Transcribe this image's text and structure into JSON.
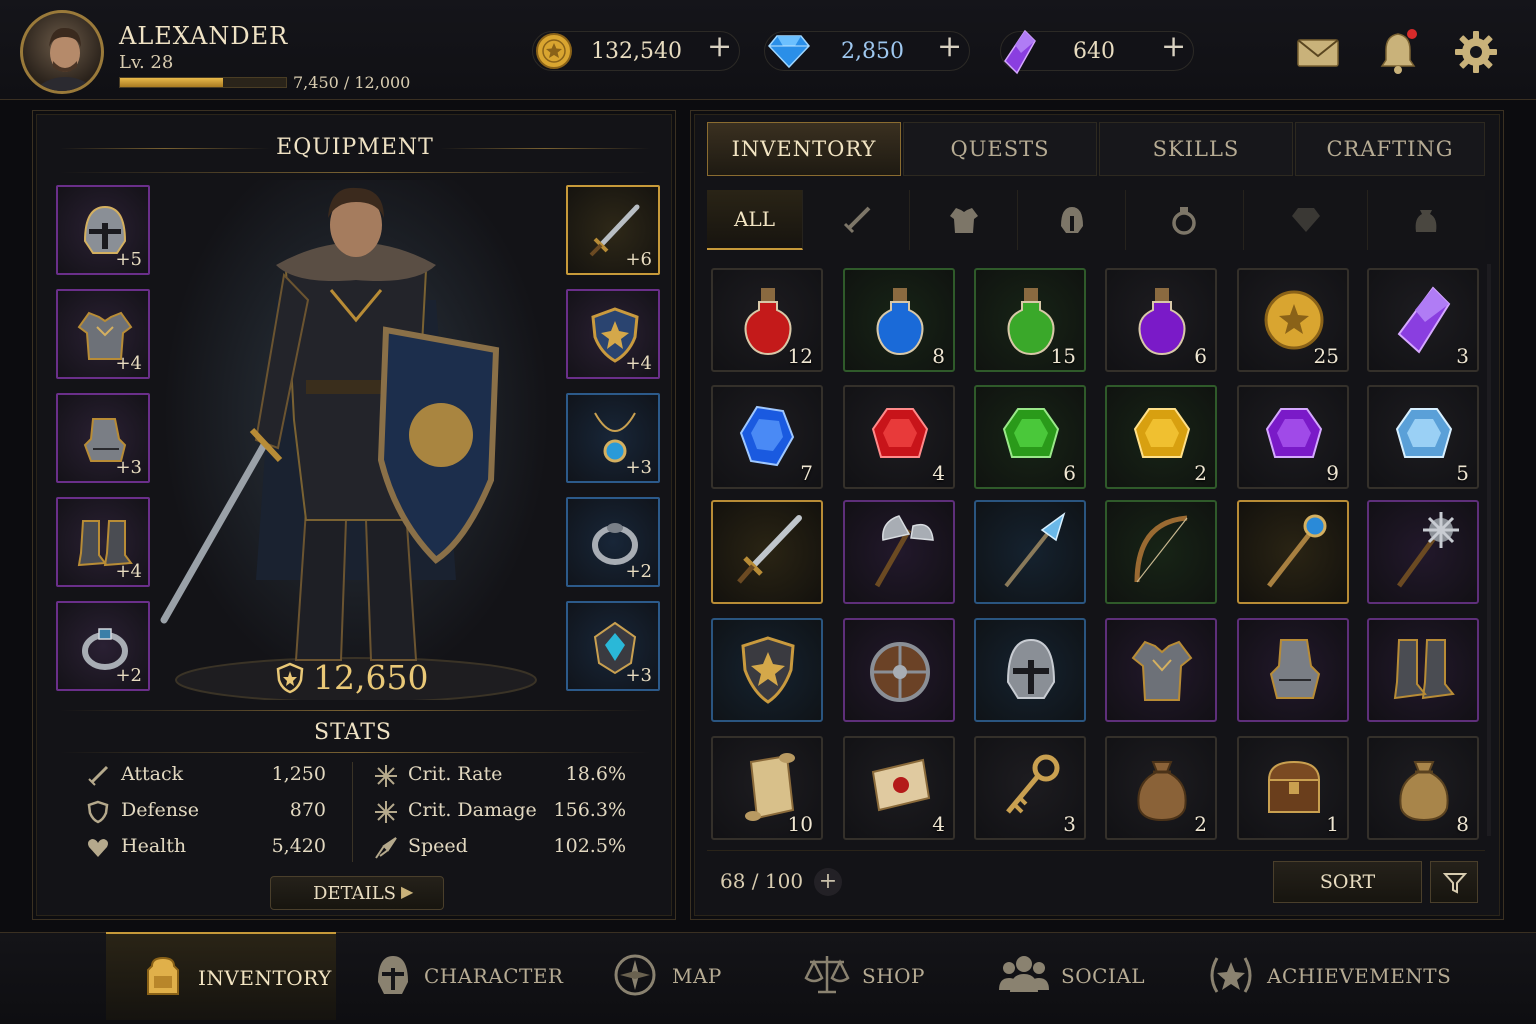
{
  "player": {
    "name": "ALEXANDER",
    "level": "Lv. 28",
    "xp_text": "7,450 / 12,000",
    "xp_progress": 0.621
  },
  "currencies": [
    {
      "name": "gold",
      "value": "132,540",
      "add": "+"
    },
    {
      "name": "gems",
      "value": "2,850",
      "add": "+"
    },
    {
      "name": "crystals",
      "value": "640",
      "add": "+"
    }
  ],
  "equipment": {
    "title": "EQUIPMENT",
    "power": "12,650",
    "left_slots": [
      {
        "icon": "helmet-icon",
        "bonus": "+5"
      },
      {
        "icon": "chest-armor-icon",
        "bonus": "+4"
      },
      {
        "icon": "gauntlets-icon",
        "bonus": "+3"
      },
      {
        "icon": "boots-icon",
        "bonus": "+4"
      },
      {
        "icon": "ring-icon",
        "bonus": "+2"
      }
    ],
    "right_slots": [
      {
        "icon": "sword-icon",
        "bonus": "+6"
      },
      {
        "icon": "shield-icon",
        "bonus": "+4"
      },
      {
        "icon": "amulet-icon",
        "bonus": "+3"
      },
      {
        "icon": "ring-icon",
        "bonus": "+2"
      },
      {
        "icon": "charm-icon",
        "bonus": "+3"
      }
    ]
  },
  "stats": {
    "title": "STATS",
    "left": [
      {
        "icon": "sword-icon",
        "label": "Attack",
        "value": "1,250"
      },
      {
        "icon": "shield-icon",
        "label": "Defense",
        "value": "870"
      },
      {
        "icon": "heart-icon",
        "label": "Health",
        "value": "5,420"
      }
    ],
    "right": [
      {
        "icon": "crit-icon",
        "label": "Crit. Rate",
        "value": "18.6%"
      },
      {
        "icon": "crit-icon",
        "label": "Crit. Damage",
        "value": "156.3%"
      },
      {
        "icon": "speed-icon",
        "label": "Speed",
        "value": "102.5%"
      }
    ],
    "details_label": "DETAILS"
  },
  "tabs": [
    "INVENTORY",
    "QUESTS",
    "SKILLS",
    "CRAFTING"
  ],
  "filters": {
    "all_label": "ALL",
    "icons": [
      "weapon-filter-icon",
      "armor-filter-icon",
      "helmet-filter-icon",
      "ring-filter-icon",
      "gem-filter-icon",
      "bag-filter-icon"
    ]
  },
  "inventory": {
    "rows": [
      [
        {
          "icon": "red-potion-icon",
          "qty": "12",
          "rarity": "none"
        },
        {
          "icon": "blue-potion-icon",
          "qty": "8",
          "rarity": "green"
        },
        {
          "icon": "green-potion-icon",
          "qty": "15",
          "rarity": "green"
        },
        {
          "icon": "purple-potion-icon",
          "qty": "6",
          "rarity": "none"
        },
        {
          "icon": "gold-coin-icon",
          "qty": "25",
          "rarity": "none"
        },
        {
          "icon": "purple-crystal-icon",
          "qty": "3",
          "rarity": "none"
        }
      ],
      [
        {
          "icon": "sapphire-icon",
          "qty": "7",
          "rarity": "none"
        },
        {
          "icon": "ruby-icon",
          "qty": "4",
          "rarity": "none"
        },
        {
          "icon": "emerald-icon",
          "qty": "6",
          "rarity": "green"
        },
        {
          "icon": "topaz-icon",
          "qty": "2",
          "rarity": "green"
        },
        {
          "icon": "amethyst-icon",
          "qty": "9",
          "rarity": "none"
        },
        {
          "icon": "diamond-icon",
          "qty": "5",
          "rarity": "none"
        }
      ],
      [
        {
          "icon": "sword-icon",
          "qty": "",
          "rarity": "gold"
        },
        {
          "icon": "axe-icon",
          "qty": "",
          "rarity": "purple"
        },
        {
          "icon": "spear-icon",
          "qty": "",
          "rarity": "blue"
        },
        {
          "icon": "bow-icon",
          "qty": "",
          "rarity": "green"
        },
        {
          "icon": "staff-icon",
          "qty": "",
          "rarity": "gold"
        },
        {
          "icon": "mace-icon",
          "qty": "",
          "rarity": "purple"
        }
      ],
      [
        {
          "icon": "shield-icon",
          "qty": "",
          "rarity": "blue"
        },
        {
          "icon": "round-shield-icon",
          "qty": "",
          "rarity": "purple"
        },
        {
          "icon": "helmet-icon",
          "qty": "",
          "rarity": "blue"
        },
        {
          "icon": "chest-armor-icon",
          "qty": "",
          "rarity": "purple"
        },
        {
          "icon": "gauntlets-icon",
          "qty": "",
          "rarity": "purple"
        },
        {
          "icon": "boots-icon",
          "qty": "",
          "rarity": "purple"
        }
      ],
      [
        {
          "icon": "scroll-icon",
          "qty": "10",
          "rarity": "none"
        },
        {
          "icon": "sealed-scroll-icon",
          "qty": "4",
          "rarity": "none"
        },
        {
          "icon": "key-icon",
          "qty": "3",
          "rarity": "none"
        },
        {
          "icon": "pouch-icon",
          "qty": "2",
          "rarity": "none"
        },
        {
          "icon": "chest-icon",
          "qty": "1",
          "rarity": "none"
        },
        {
          "icon": "pouch-icon",
          "qty": "8",
          "rarity": "none"
        }
      ]
    ],
    "capacity": "68 / 100",
    "add": "+",
    "sort_label": "SORT"
  },
  "bottom_nav": [
    {
      "icon": "backpack-icon",
      "label": "INVENTORY"
    },
    {
      "icon": "helmet-icon",
      "label": "CHARACTER"
    },
    {
      "icon": "compass-icon",
      "label": "MAP"
    },
    {
      "icon": "scales-icon",
      "label": "SHOP"
    },
    {
      "icon": "people-icon",
      "label": "SOCIAL"
    },
    {
      "icon": "laurel-star-icon",
      "label": "ACHIEVEMENTS"
    }
  ],
  "colors": {
    "accent": "#c79a3a",
    "rarity_green": "#2f5a2a",
    "rarity_purple": "#5e2f7a",
    "rarity_blue": "#2a5580",
    "rarity_gold": "#b88c36"
  }
}
